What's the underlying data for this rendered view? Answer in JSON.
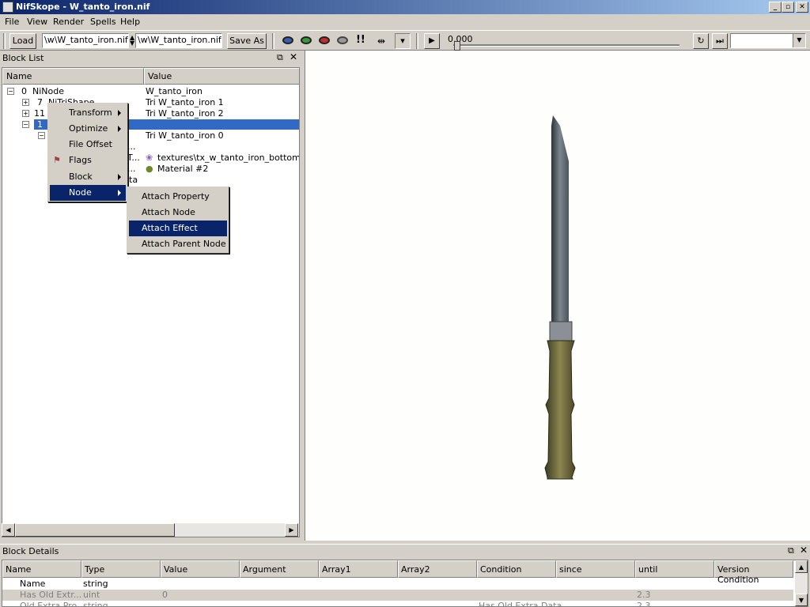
{
  "window": {
    "title": "NifSkope - W_tanto_iron.nif",
    "btn_min": "_",
    "btn_max": "▫",
    "btn_close": "✕"
  },
  "menubar": [
    "File",
    "View",
    "Render",
    "Spells",
    "Help"
  ],
  "toolbar": {
    "load_label": "Load",
    "load_path": "\\w\\W_tanto_iron.nif",
    "save_path": "\\w\\W_tanto_iron.nif",
    "save_label": "Save As",
    "time_value": "0.000",
    "play_icon": "▶"
  },
  "blocklist": {
    "title": "Block List",
    "col_name": "Name",
    "col_value": "Value",
    "rows": [
      {
        "num": "0",
        "name": "NiNode",
        "value": "W_tanto_iron"
      },
      {
        "num": "7",
        "name": "NiTriShape",
        "value": "Tri W_tanto_iron 1"
      },
      {
        "num": "11",
        "name": "",
        "value": "Tri W_tanto_iron 2"
      },
      {
        "num": "1",
        "name": "",
        "value": ""
      },
      {
        "num": "",
        "name": "",
        "value": "Tri W_tanto_iron 0"
      },
      {
        "num": "",
        "name": "...",
        "value": ""
      },
      {
        "num": "",
        "name": "T...",
        "value": "textures\\tx_w_tanto_iron_bottom.dds"
      },
      {
        "num": "",
        "name": "...",
        "value": "Material #2"
      },
      {
        "num": "",
        "name": "ta",
        "value": ""
      }
    ]
  },
  "context_menu": {
    "items": [
      "Transform",
      "Optimize",
      "File Offset",
      "Flags",
      "Block",
      "Node"
    ],
    "selected": "Node"
  },
  "node_submenu": {
    "items": [
      "Attach Property",
      "Attach Node",
      "Attach Effect",
      "Attach Parent Node"
    ],
    "selected": "Attach Effect"
  },
  "details": {
    "title": "Block Details",
    "columns": [
      "Name",
      "Type",
      "Value",
      "Argument",
      "Array1",
      "Array2",
      "Condition",
      "since",
      "until",
      "Version Condition"
    ],
    "rows": [
      {
        "name": "Name",
        "type": "string",
        "value": "",
        "condition": "",
        "until": ""
      },
      {
        "name": "Has Old Extr...",
        "type": "uint",
        "value": "0",
        "condition": "",
        "until": "2.3"
      },
      {
        "name": "Old Extra Pro...",
        "type": "string",
        "value": "",
        "condition": "Has Old Extra Data",
        "until": "2.3"
      }
    ]
  },
  "colors": {
    "accent": "#0a246a",
    "tree_selection": "#316ac5"
  }
}
